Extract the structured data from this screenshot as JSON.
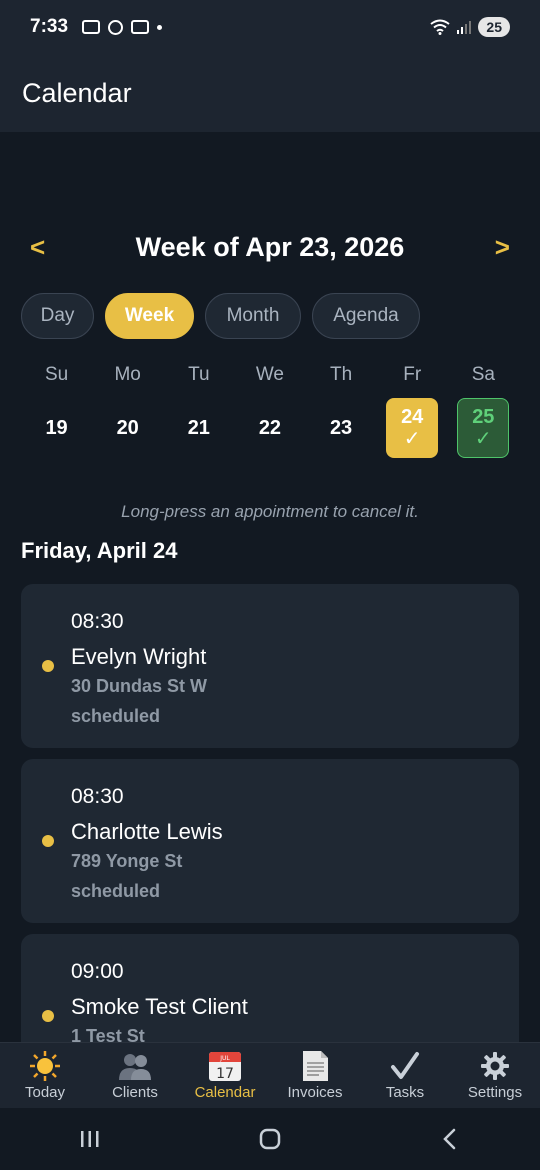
{
  "status": {
    "time": "7:33",
    "battery": "25"
  },
  "app": {
    "title": "Calendar"
  },
  "week": {
    "prev": "<",
    "title": "Week of Apr 23, 2026",
    "next": ">"
  },
  "views": [
    {
      "label": "Day",
      "active": false
    },
    {
      "label": "Week",
      "active": true
    },
    {
      "label": "Month",
      "active": false
    },
    {
      "label": "Agenda",
      "active": false
    }
  ],
  "days": [
    {
      "dow": "Su",
      "date": "19"
    },
    {
      "dow": "Mo",
      "date": "20"
    },
    {
      "dow": "Tu",
      "date": "21"
    },
    {
      "dow": "We",
      "date": "22"
    },
    {
      "dow": "Th",
      "date": "23"
    },
    {
      "dow": "Fr",
      "date": "24",
      "check": "✓"
    },
    {
      "dow": "Sa",
      "date": "25",
      "check": "✓"
    }
  ],
  "hint": "Long-press an appointment to cancel it.",
  "section_title": "Friday, April 24",
  "appointments": [
    {
      "time": "08:30",
      "name": "Evelyn Wright",
      "address": "30 Dundas St W",
      "status": "scheduled"
    },
    {
      "time": "08:30",
      "name": "Charlotte Lewis",
      "address": "789 Yonge St",
      "status": "scheduled"
    },
    {
      "time": "09:00",
      "name": "Smoke Test Client",
      "address": "1 Test St",
      "status": ""
    }
  ],
  "nav": [
    {
      "label": "Today",
      "icon": "sun-icon"
    },
    {
      "label": "Clients",
      "icon": "people-icon"
    },
    {
      "label": "Calendar",
      "icon": "calendar-icon",
      "icon_month": "JUL",
      "icon_day": "17",
      "active": true
    },
    {
      "label": "Invoices",
      "icon": "invoice-icon"
    },
    {
      "label": "Tasks",
      "icon": "check-icon"
    },
    {
      "label": "Settings",
      "icon": "gear-icon"
    }
  ],
  "colors": {
    "accent": "#e8bf45",
    "green": "#4fc46a",
    "background": "#121922",
    "card": "#1f2833"
  }
}
